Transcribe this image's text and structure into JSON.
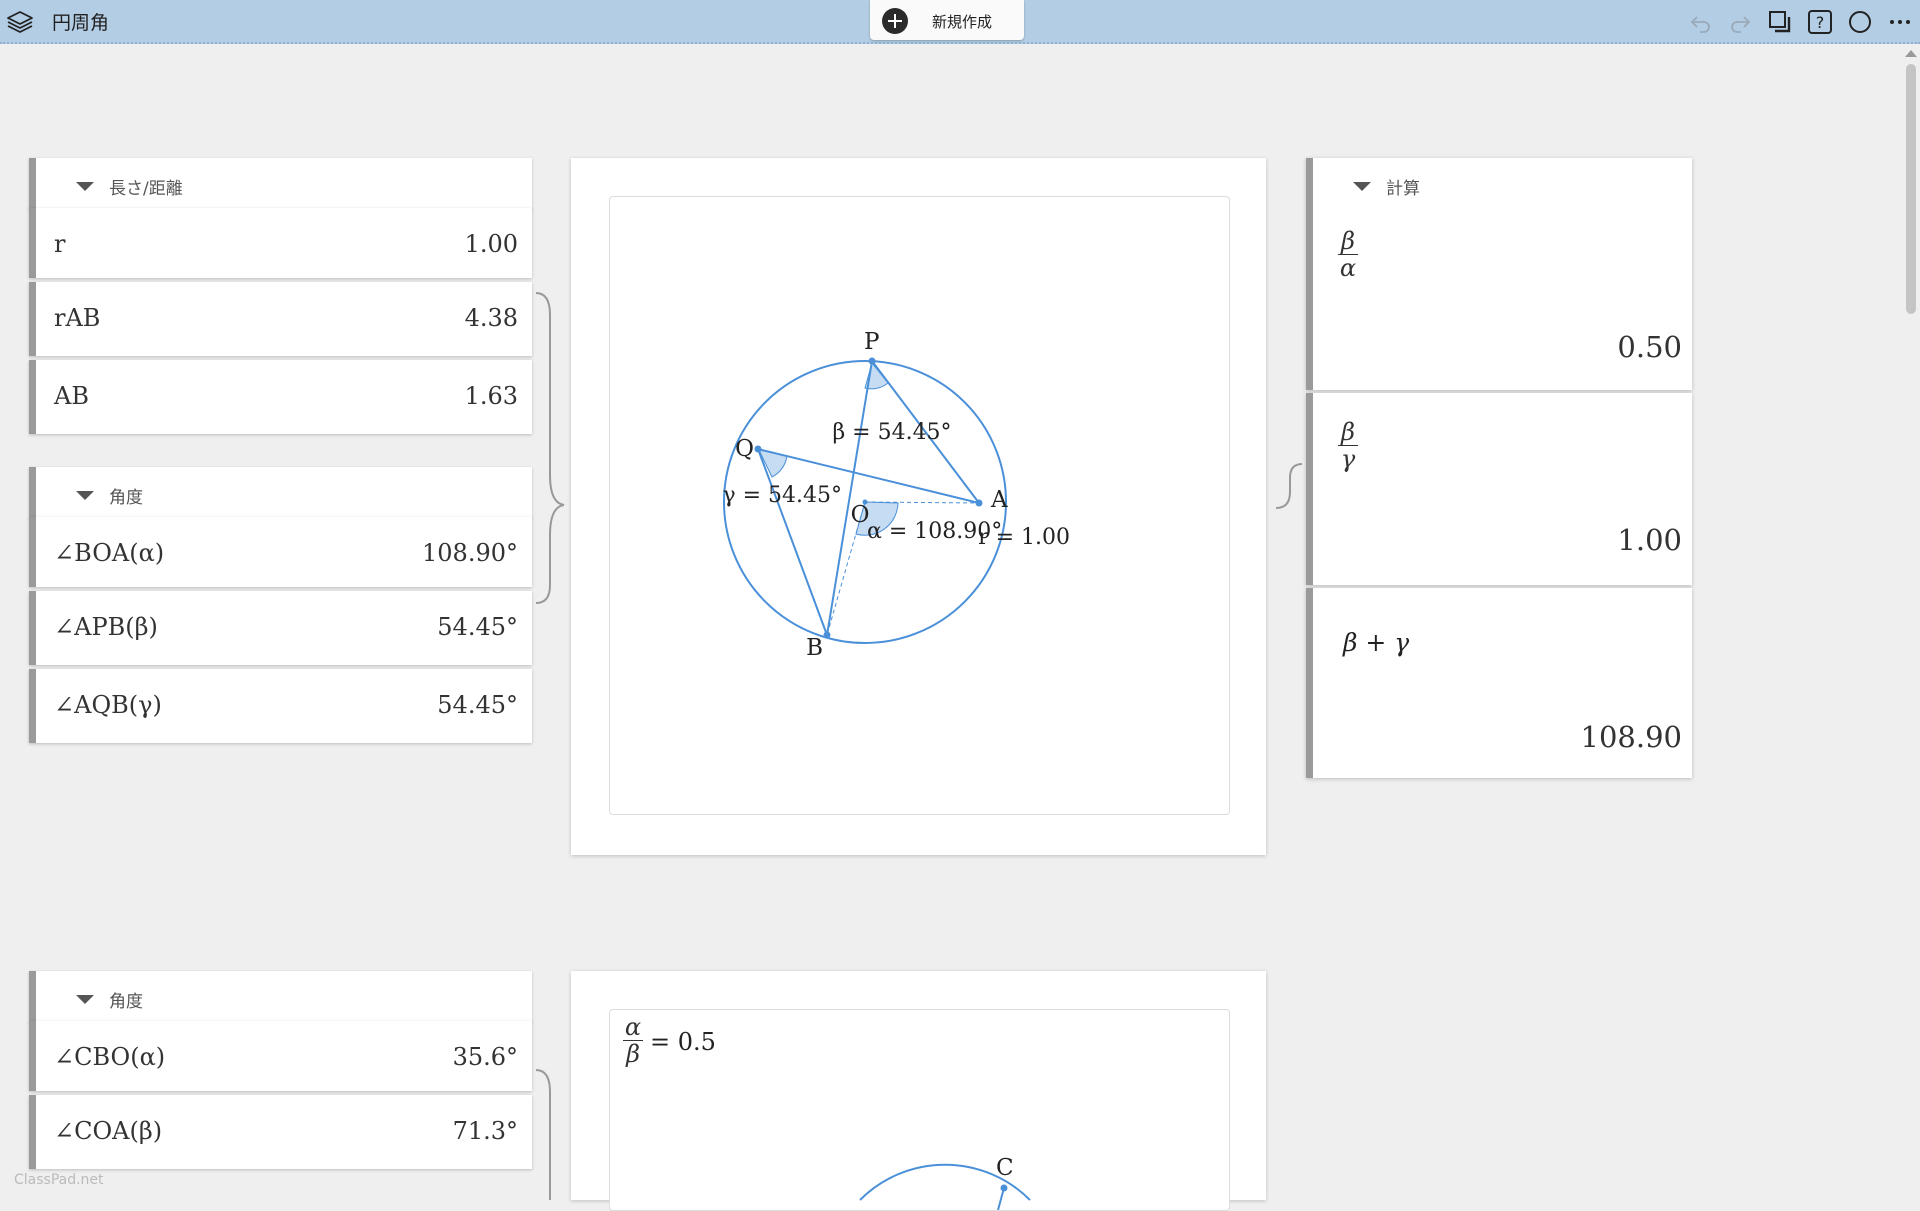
{
  "app": {
    "title": "円周角",
    "new_button_label": "新規作成",
    "watermark": "ClassPad.net"
  },
  "icons": {
    "layers": "layers-icon",
    "new": "plus-circle-icon",
    "undo": "undo-icon",
    "redo": "redo-icon",
    "copy": "copy-icon",
    "help": "help-icon",
    "circle": "circle-icon",
    "more": "more-icon"
  },
  "length_panel": {
    "header": "長さ/距離",
    "rows": [
      {
        "name": "r",
        "value": "1.00"
      },
      {
        "name": "rAB",
        "value": "4.38"
      },
      {
        "name": "AB",
        "value": "1.63"
      }
    ]
  },
  "angle_panel": {
    "header": "角度",
    "rows": [
      {
        "name": "∠BOA(α)",
        "value": "108.90°"
      },
      {
        "name": "∠APB(β)",
        "value": "54.45°"
      },
      {
        "name": "∠AQB(γ)",
        "value": "54.45°"
      }
    ]
  },
  "angle_panel_2": {
    "header": "角度",
    "rows": [
      {
        "name": "∠CBO(α)",
        "value": "35.6°"
      },
      {
        "name": "∠COA(β)",
        "value": "71.3°"
      }
    ]
  },
  "diagram": {
    "points": {
      "P": "P",
      "Q": "Q",
      "O": "O",
      "A": "A",
      "B": "B"
    },
    "labels": {
      "beta": "β = 54.45°",
      "gamma": "γ = 54.45°",
      "alpha": "α = 108.90°",
      "radius": "r = 1.00"
    }
  },
  "calc_panel": {
    "header": "計算",
    "items": [
      {
        "num": "β",
        "den": "α",
        "result": "0.50"
      },
      {
        "num": "β",
        "den": "γ",
        "result": "1.00"
      },
      {
        "expr": "β + γ",
        "result": "108.90"
      }
    ]
  },
  "second_diagram": {
    "num": "α",
    "den": "β",
    "equation_rhs": "= 0.5",
    "point_c": "C"
  },
  "colors": {
    "topbar": "#b3cde4",
    "geometry": "#4a90d9",
    "angle_fill": "#c5dcf3"
  }
}
